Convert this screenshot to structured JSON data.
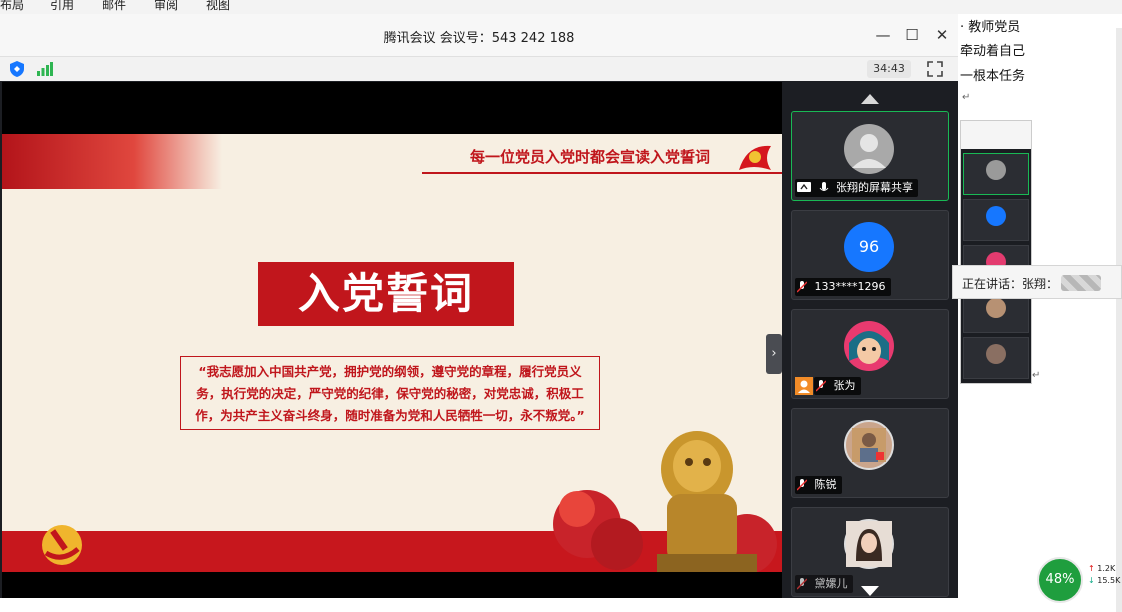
{
  "ribbon": {
    "tabs": [
      "布局",
      "引用",
      "邮件",
      "审阅",
      "视图"
    ]
  },
  "document": {
    "lines": [
      "· 教师党员",
      "牵动着自己",
      "一根本任务"
    ]
  },
  "meeting": {
    "title": "腾讯会议 会议号：543 242 188",
    "timer": "34:43",
    "window_controls": {
      "minimize": "—",
      "maximize": "☐",
      "close": "✕"
    }
  },
  "slide": {
    "headline": "每一位党员入党时都会宣读入党誓词",
    "banner": "入党誓词",
    "oath": "“我志愿加入中国共产党，拥护党的纲领，遵守党的章程，履行党员义务，执行党的决定，严守党的纪律，保守党的秘密，对党忠诚，积极工作，为共产主义奋斗终身，随时准备为党和人民牺牲一切，永不叛党。”"
  },
  "participants": [
    {
      "name": "张翔的屏幕共享",
      "avatar": "default-avatar",
      "muted": false,
      "sharing": true
    },
    {
      "name": "133****1296",
      "avatar_text": "96",
      "avatar_color": "#1677ff",
      "muted": true
    },
    {
      "name": "张为",
      "avatar": "cartoon-avatar",
      "muted": true
    },
    {
      "name": "陈锐",
      "avatar": "photo-avatar",
      "muted": true
    },
    {
      "name": "黛嫘儿",
      "avatar": "photo-avatar",
      "muted": true
    }
  ],
  "speaking": {
    "label": "正在讲话：张翔："
  },
  "status": {
    "battery": "48%",
    "up": "1.2K",
    "down": "15.5K"
  },
  "colors": {
    "party_red": "#c1161c",
    "active_green": "#19b955",
    "panel_bg": "#1c1e23"
  }
}
